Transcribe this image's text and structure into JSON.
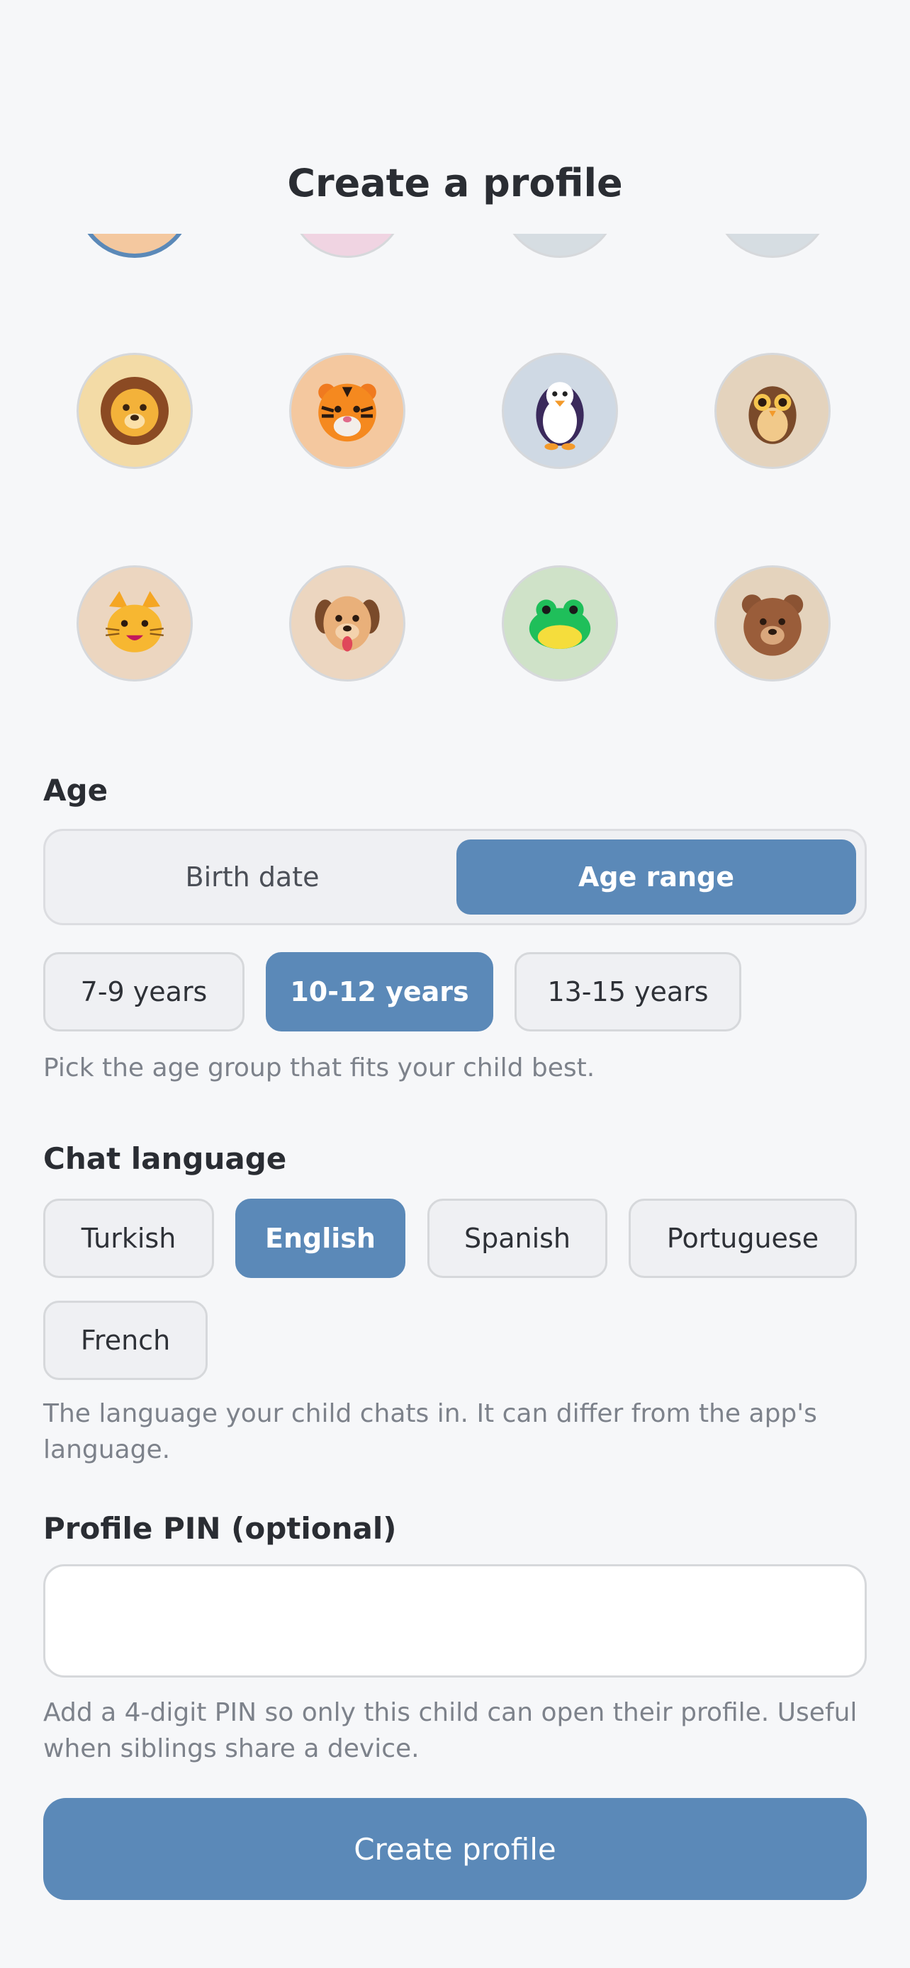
{
  "header": {
    "title": "Create a profile"
  },
  "avatars": [
    {
      "name": "blue-avatar",
      "bg": "#f4c89f",
      "ring": "#5b89b8"
    },
    {
      "name": "pink-avatar",
      "bg": "#f0d4e2"
    },
    {
      "name": "grey-avatar-1",
      "bg": "#d6dde2"
    },
    {
      "name": "grey-avatar-2",
      "bg": "#d6dde2"
    },
    {
      "name": "lion-icon",
      "bg": "#f3dba6"
    },
    {
      "name": "tiger-icon",
      "bg": "#f4c89f"
    },
    {
      "name": "penguin-icon",
      "bg": "#cfd9e4"
    },
    {
      "name": "owl-icon",
      "bg": "#e4d3bd"
    },
    {
      "name": "cat-icon",
      "bg": "#ecd6c0"
    },
    {
      "name": "dog-icon",
      "bg": "#ecd6c0"
    },
    {
      "name": "frog-icon",
      "bg": "#cfe2c8"
    },
    {
      "name": "bear-icon",
      "bg": "#e4d3bd"
    }
  ],
  "age": {
    "label": "Age",
    "modes": [
      "Birth date",
      "Age range"
    ],
    "selected_mode": "Age range",
    "ranges": [
      "7-9 years",
      "10-12 years",
      "13-15 years"
    ],
    "selected_range": "10-12 years",
    "hint": "Pick the age group that fits your child best."
  },
  "language": {
    "label": "Chat language",
    "options": [
      "Turkish",
      "English",
      "Spanish",
      "Portuguese",
      "French"
    ],
    "selected": "English",
    "hint": "The language your child chats in. It can differ from the app's language."
  },
  "pin": {
    "label": "Profile PIN (optional)",
    "value": "",
    "placeholder": "",
    "hint": "Add a 4-digit PIN so only this child can open their profile. Useful when siblings share a device."
  },
  "submit": {
    "label": "Create profile"
  },
  "colors": {
    "accent": "#5b89b8",
    "background": "#f6f7f9"
  }
}
